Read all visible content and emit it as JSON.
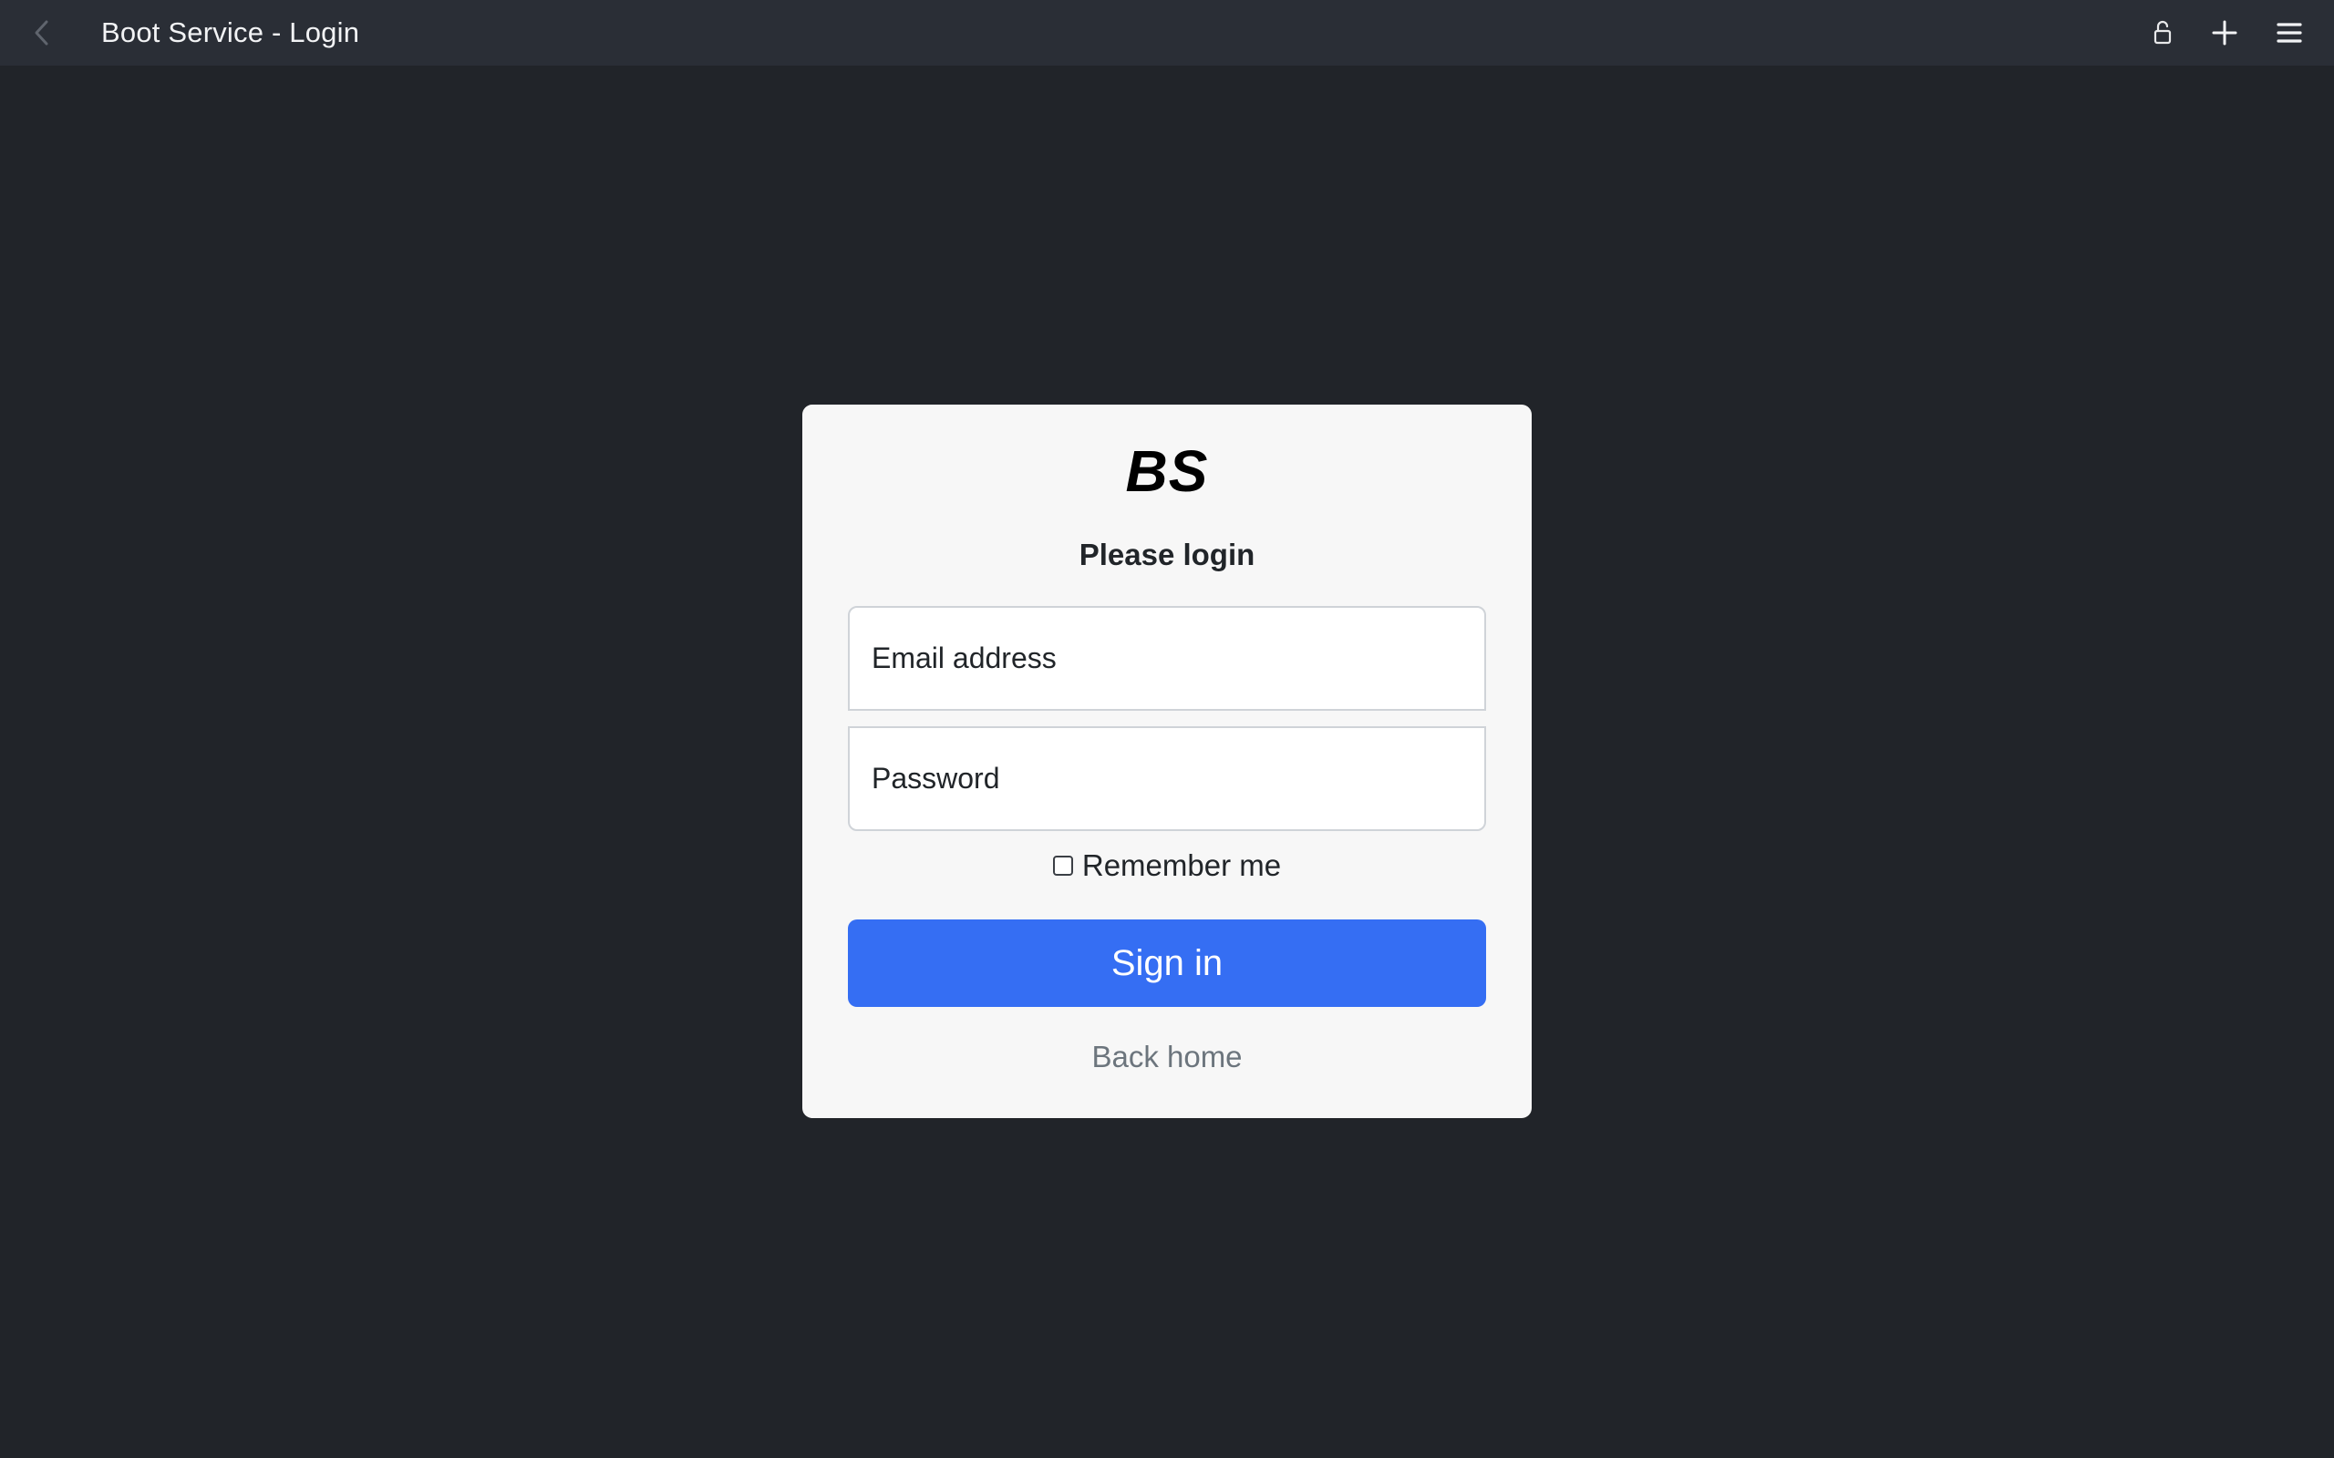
{
  "window": {
    "title": "Boot Service - Login"
  },
  "toolbar": {
    "back_icon": "chevron-left-icon",
    "lock_icon": "lock-icon",
    "plus_icon": "plus-icon",
    "menu_icon": "hamburger-menu-icon"
  },
  "login": {
    "logo": "BS",
    "heading": "Please login",
    "email_placeholder": "Email address",
    "email_value": "",
    "password_placeholder": "Password",
    "password_value": "",
    "remember_label": "Remember me",
    "remember_checked": false,
    "signin_label": "Sign in",
    "back_home_label": "Back home"
  },
  "colors": {
    "page_background": "#212429",
    "topbar_background": "#2a2e36",
    "card_background": "#f7f7f7",
    "primary_button": "#356ef3",
    "muted_link": "#6c757d"
  }
}
